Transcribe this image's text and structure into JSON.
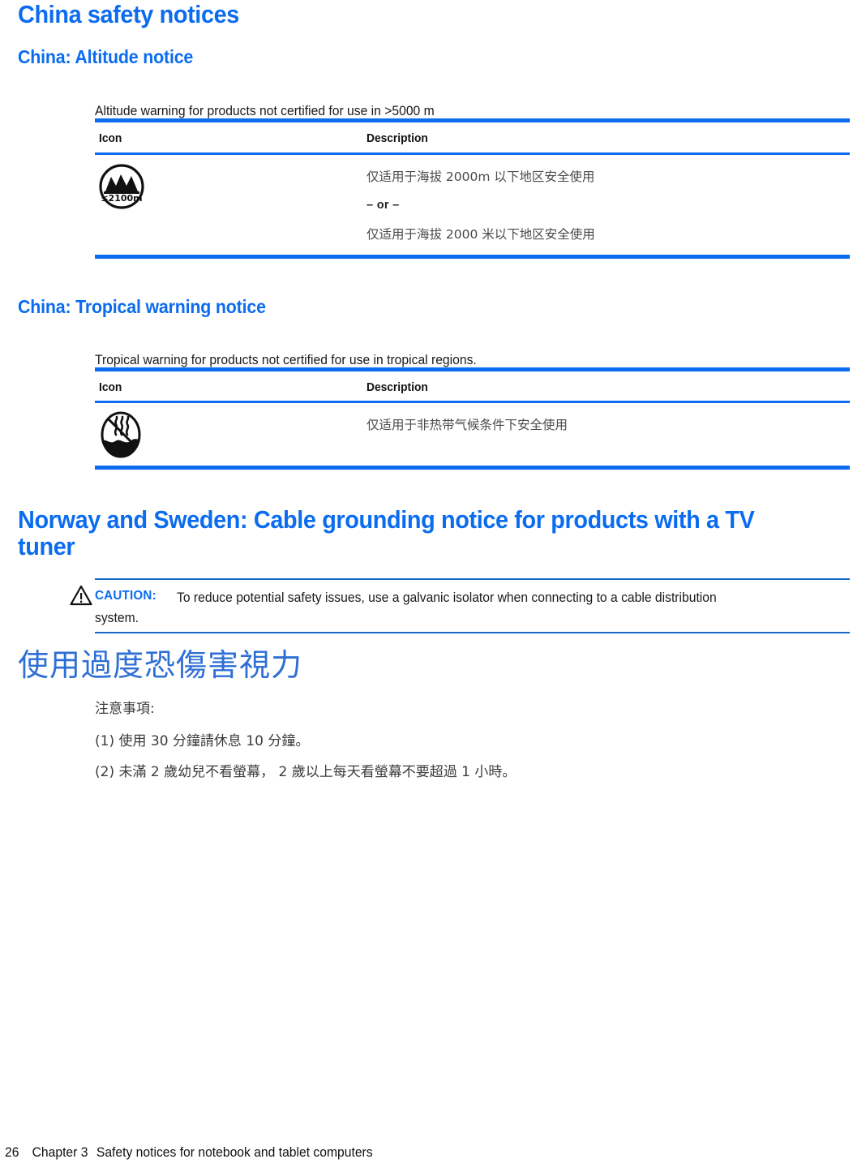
{
  "document": {
    "section_title": "China safety notices"
  },
  "altitude": {
    "heading": "China: Altitude notice",
    "intro": "Altitude warning for products not certified for use in >5000 m",
    "table": {
      "headers": [
        "Icon",
        "Description"
      ],
      "icon_name": "altitude-limit-2100m-icon",
      "icon_label": "≤2100m",
      "description_line_1": "仅适用于海拔 2000m 以下地区安全使用",
      "separator": "– or –",
      "description_line_2": "仅适用于海拔 2000 米以下地区安全使用"
    }
  },
  "tropical": {
    "heading": "China: Tropical warning notice",
    "intro": "Tropical warning for products not certified for use in tropical regions.",
    "table": {
      "headers": [
        "Icon",
        "Description"
      ],
      "icon_name": "non-tropical-climate-icon",
      "description": "仅适用于非热带气候条件下安全使用"
    }
  },
  "cable_grounding": {
    "heading": "Norway and Sweden: Cable grounding notice for products with a TV tuner",
    "caution_label": "CAUTION:",
    "caution_text": "To reduce potential safety issues, use a galvanic isolator when connecting to a cable distribution system.",
    "caution_text_line1": "To reduce potential safety issues, use a galvanic isolator when connecting to a cable distribution",
    "caution_text_line2": "system."
  },
  "eye_strain": {
    "heading": "使用過度恐傷害視力",
    "intro": "注意事項:",
    "item_1": "(1) 使用 30 分鐘請休息 10 分鐘。",
    "item_2": "(2) 未滿 2 歲幼兒不看螢幕， 2 歲以上每天看螢幕不要超過 1 小時。"
  },
  "footer": {
    "page_number": "26",
    "chapter": "Chapter 3",
    "chapter_title": "Safety notices for notebook and tablet computers"
  },
  "colors": {
    "heading_blue": "#0b6cf0",
    "cjk_heading_blue": "#2e6fd4",
    "rule_blue": "#0b6cf0",
    "body_black": "#1a1a1a"
  }
}
